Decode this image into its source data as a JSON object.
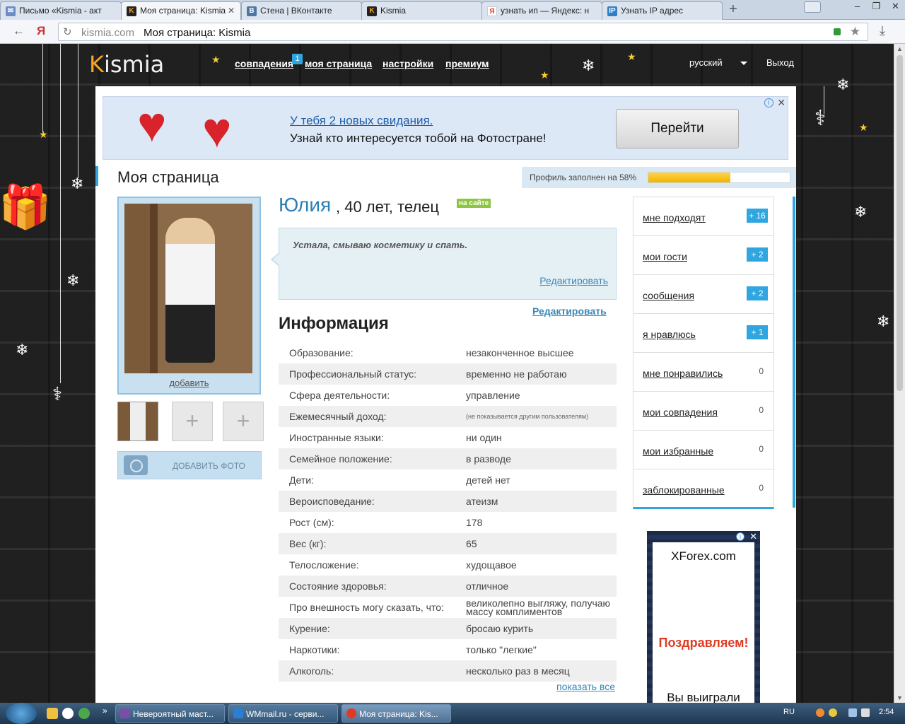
{
  "browser": {
    "tabs": [
      {
        "title": "Письмо «Kismia - акт",
        "icon": "mail-icon",
        "color": "#6b8cc7"
      },
      {
        "title": "Моя страница: Kismia",
        "icon": "kismia-icon",
        "color": "#222222",
        "active": true
      },
      {
        "title": "Стена | ВКонтакте",
        "icon": "vk-icon",
        "color": "#4a76a8"
      },
      {
        "title": "Kismia",
        "icon": "kismia-icon",
        "color": "#222222"
      },
      {
        "title": "узнать ип — Яндекс: н",
        "icon": "yandex-icon",
        "color": "#e03a22"
      },
      {
        "title": "Узнать IP адрес",
        "icon": "ip-icon",
        "color": "#2f7fc7"
      }
    ],
    "yandex_glyph": "Я",
    "url_host": "kismia.com",
    "url_title": "Моя страница: Kismia"
  },
  "header": {
    "logo_k": "K",
    "logo_rest": "ismia",
    "nav": [
      {
        "label": "совпадения"
      },
      {
        "label": "моя страница"
      },
      {
        "label": "настройки"
      },
      {
        "label": "премиум"
      }
    ],
    "matches_badge": "1",
    "language": "русский",
    "logout": "Выход"
  },
  "ad_banner": {
    "link": "У тебя 2 новых свидания.",
    "text": "Узнай кто интересуется тобой на Фотостране!",
    "button": "Перейти"
  },
  "page": {
    "title": "Моя страница",
    "completion_text": "Профиль заполнен на 58%",
    "completion_percent": 58
  },
  "photos": {
    "add_link": "добавить",
    "add_photo": "ДОБАВИТЬ ФОТО"
  },
  "profile": {
    "name": "Юлия",
    "details": ", 40 лет, телец",
    "online_badge": "на сайте",
    "status": "Устала, смываю косметику и спать.",
    "status_edit": "Редактировать",
    "info_edit": "Редактировать",
    "info_title": "Информация",
    "info": [
      {
        "key": "Образование:",
        "value": "незаконченное высшее"
      },
      {
        "key": "Профессиональный статус:",
        "value": "временно не работаю"
      },
      {
        "key": "Сфера деятельности:",
        "value": "управление"
      },
      {
        "key": "Ежемесячный доход:",
        "value": "(не показывается другим пользователям)"
      },
      {
        "key": "Иностранные языки:",
        "value": "ни один"
      },
      {
        "key": "Семейное положение:",
        "value": "в разводе"
      },
      {
        "key": "Дети:",
        "value": "детей нет"
      },
      {
        "key": "Вероисповедание:",
        "value": "атеизм"
      },
      {
        "key": "Рост (см):",
        "value": "178"
      },
      {
        "key": "Вес (кг):",
        "value": "65"
      },
      {
        "key": "Телосложение:",
        "value": "худощавое"
      },
      {
        "key": "Состояние здоровья:",
        "value": "отличное"
      },
      {
        "key": "Про внешность могу сказать, что:",
        "value": "великолепно выгляжу, получаю массу комплиментов"
      },
      {
        "key": "Курение:",
        "value": "бросаю курить"
      },
      {
        "key": "Наркотики:",
        "value": "только \"легкие\""
      },
      {
        "key": "Алкоголь:",
        "value": "несколько раз в месяц"
      }
    ],
    "show_all": "показать все"
  },
  "sidebar": {
    "items": [
      {
        "label": "мне подходят",
        "count": "+ 16",
        "highlight": true
      },
      {
        "label": "мои гости",
        "count": "+ 2",
        "highlight": true
      },
      {
        "label": "сообщения",
        "count": "+ 2",
        "highlight": true
      },
      {
        "label": "я нравлюсь",
        "count": "+ 1",
        "highlight": true
      },
      {
        "label": "мне понравились",
        "count": "0",
        "highlight": false
      },
      {
        "label": "мои совпадения",
        "count": "0",
        "highlight": false
      },
      {
        "label": "мои избранные",
        "count": "0",
        "highlight": false
      },
      {
        "label": "заблокированные",
        "count": "0",
        "highlight": false
      }
    ]
  },
  "ad_side": {
    "title": "XForex.com",
    "congrats": "Поздравляем!",
    "won": "Вы выиграли"
  },
  "taskbar": {
    "items": [
      {
        "label": "Невероятный маст...",
        "color": "#7a4ea8"
      },
      {
        "label": "WMmail.ru - серви...",
        "color": "#2a7fd4"
      },
      {
        "label": "Моя страница: Kis...",
        "color": "#e03a22",
        "active": true
      }
    ],
    "lang": "RU",
    "time": "2:54"
  },
  "colors": {
    "accent": "#2fa6df",
    "link": "#3a88b8",
    "name": "#2a7fb5",
    "progress": "#f3b400"
  }
}
